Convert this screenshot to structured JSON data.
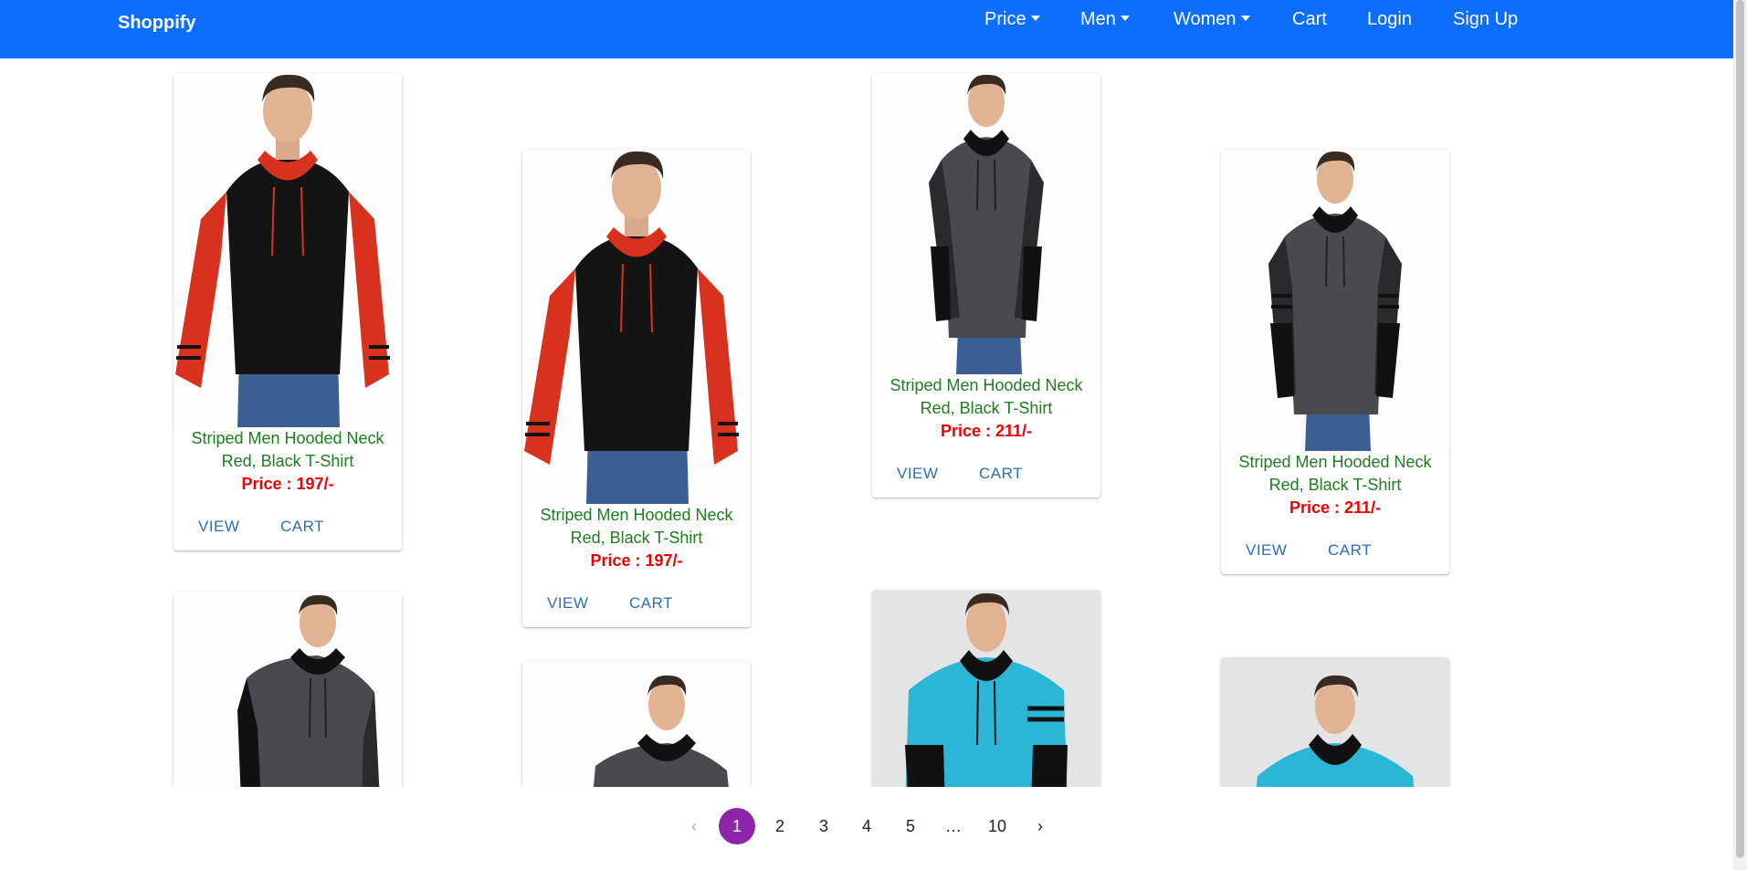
{
  "navbar": {
    "brand": "Shoppify",
    "items": [
      {
        "label": "Price",
        "dropdown": true
      },
      {
        "label": "Men",
        "dropdown": true
      },
      {
        "label": "Women",
        "dropdown": true
      },
      {
        "label": "Cart",
        "dropdown": false
      },
      {
        "label": "Login",
        "dropdown": false
      },
      {
        "label": "Sign Up",
        "dropdown": false
      }
    ]
  },
  "products": [
    {
      "title": "Striped Men Hooded Neck Red, Black T-Shirt",
      "price": "Price : 197/-",
      "view": "VIEW",
      "cart": "CART",
      "style": "red-black"
    },
    {
      "title": "Striped Men Hooded Neck Red, Black T-Shirt",
      "price": "Price : 197/-",
      "view": "VIEW",
      "cart": "CART",
      "style": "red-black"
    },
    {
      "title": "Striped Men Hooded Neck Red, Black T-Shirt",
      "price": "Price : 211/-",
      "view": "VIEW",
      "cart": "CART",
      "style": "grey-black"
    },
    {
      "title": "Striped Men Hooded Neck Red, Black T-Shirt",
      "price": "Price : 211/-",
      "view": "VIEW",
      "cart": "CART",
      "style": "grey-black"
    }
  ],
  "partial_products": [
    {
      "style": "grey-black"
    },
    {
      "style": "grey-black"
    },
    {
      "style": "cyan-black"
    },
    {
      "style": "cyan-black"
    }
  ],
  "pagination": {
    "prev": "‹",
    "pages": [
      "1",
      "2",
      "3",
      "4",
      "5",
      "…",
      "10"
    ],
    "current": "1",
    "next": "›"
  },
  "colors": {
    "navbar": "#0d6efd",
    "title": "#1e7e1e",
    "price": "#f00000",
    "action": "#2f6db5",
    "active_page": "#8e24aa"
  }
}
